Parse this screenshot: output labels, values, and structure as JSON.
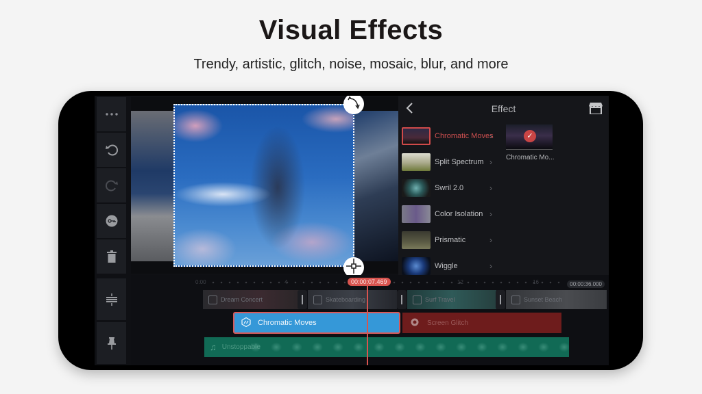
{
  "header": {
    "title": "Visual Effects",
    "subtitle": "Trendy, artistic, glitch, noise, mosaic, blur, and more"
  },
  "toolbar": {
    "items": [
      {
        "name": "more",
        "icon": "more-horizontal-icon"
      },
      {
        "name": "undo",
        "icon": "undo-icon"
      },
      {
        "name": "redo",
        "icon": "redo-icon"
      },
      {
        "name": "keyframe",
        "icon": "key-icon"
      },
      {
        "name": "delete",
        "icon": "trash-icon"
      },
      {
        "name": "split-tracks",
        "icon": "track-height-icon"
      },
      {
        "name": "pin",
        "icon": "pin-icon"
      }
    ]
  },
  "effect_panel": {
    "title": "Effect",
    "back_icon": "chevron-left-icon",
    "store_icon": "store-icon",
    "effects": [
      {
        "label": "Chromatic Moves",
        "selected": true,
        "thumb": "#3a2a40"
      },
      {
        "label": "Split Spectrum",
        "selected": false,
        "thumb": "#8a8a6a"
      },
      {
        "label": "Swril 2.0",
        "selected": false,
        "thumb": "#2a4a4a"
      },
      {
        "label": "Color Isolation",
        "selected": false,
        "thumb": "#6a6a7a"
      },
      {
        "label": "Prismatic",
        "selected": false,
        "thumb": "#4a4a3a"
      },
      {
        "label": "Wiggle",
        "selected": false,
        "thumb": "#1a3a6a"
      }
    ],
    "preset": {
      "label": "Chromatic Mo...",
      "check_icon": "check-icon"
    }
  },
  "timeline": {
    "ruler_start": "0:00",
    "ruler_marks": [
      "4",
      "12",
      "16"
    ],
    "current_time": "00:00:07.469",
    "total_time": "00:00:36.000",
    "video_clips": [
      "Dream Concert",
      "Skateboarding",
      "Surf Travel",
      "Sunset Beach"
    ],
    "effect_clips": [
      {
        "label": "Chromatic Moves",
        "color": "#3598d8",
        "selected": true
      },
      {
        "label": "Screen Glitch",
        "color": "#6e1c1c",
        "selected": false
      }
    ],
    "audio_clip": {
      "label": "Unstoppable",
      "color": "#116a55"
    },
    "playhead_color": "#d9544f"
  }
}
